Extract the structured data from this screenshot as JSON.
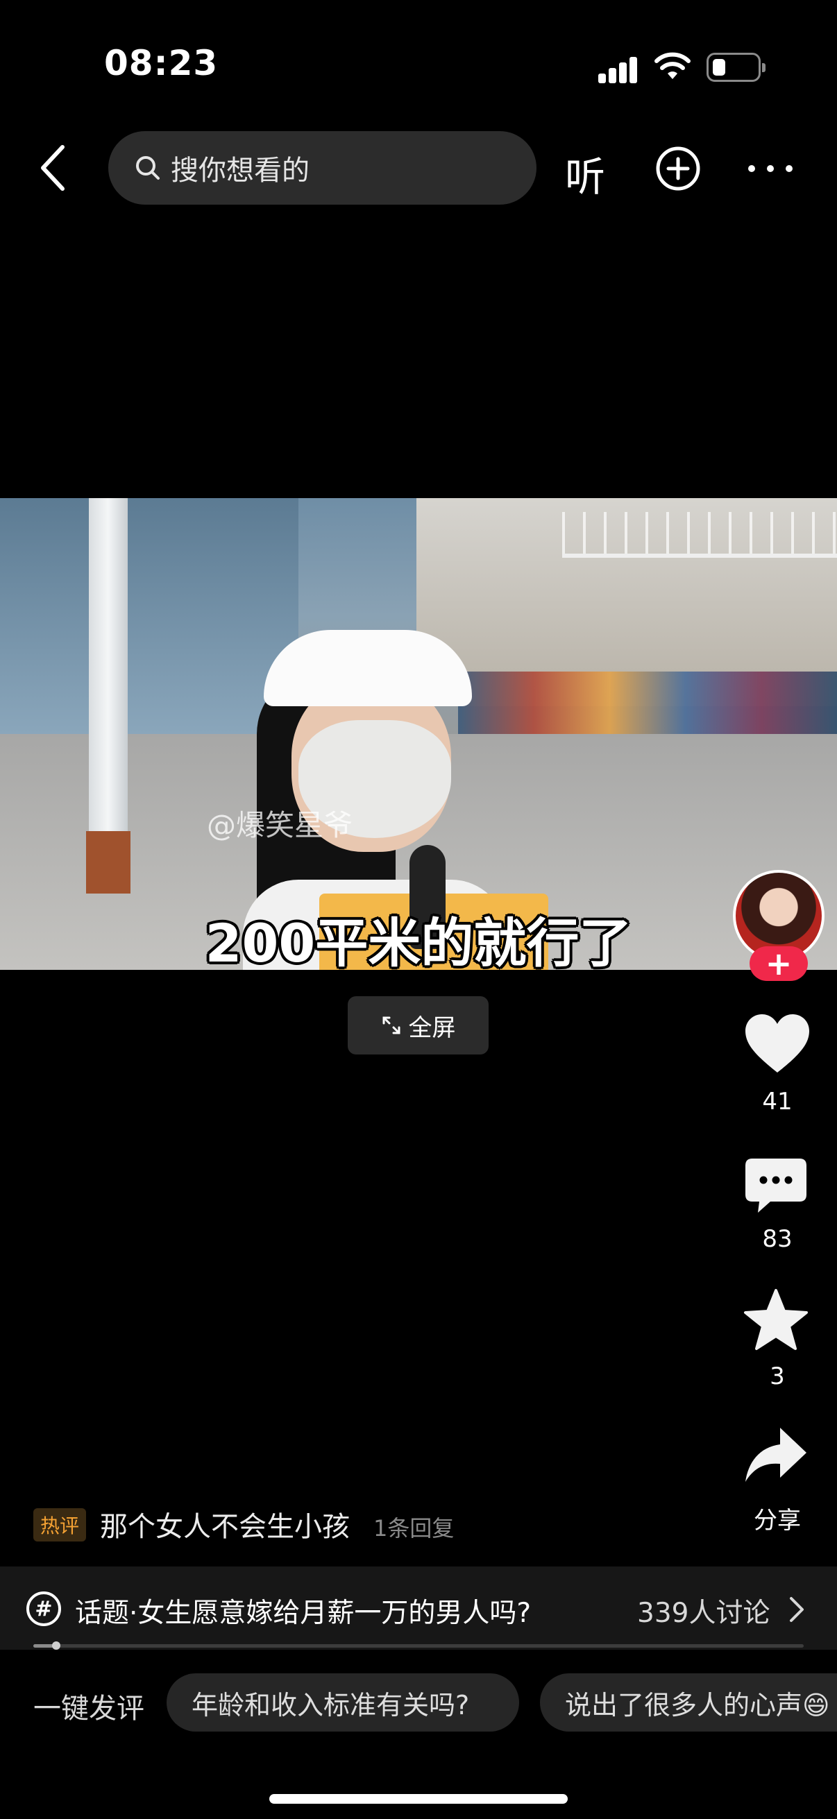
{
  "status_bar": {
    "time": "08:23",
    "battery_percent": 20
  },
  "top_nav": {
    "search_placeholder": "搜你想看的",
    "listen_label": "听",
    "icons": [
      "back-icon",
      "search-icon",
      "add-circle-icon",
      "more-icon"
    ]
  },
  "video": {
    "watermark": "@爆笑星爷",
    "subtitle": "200平米的就行了",
    "fullscreen_label": "全屏"
  },
  "actions": {
    "like_count": "41",
    "comment_count": "83",
    "favorite_count": "3",
    "share_label": "分享",
    "follow_plus": "+"
  },
  "hot_comment": {
    "tag": "热评",
    "text": "那个女人不会生小孩",
    "replies": "1条回复"
  },
  "topic": {
    "text": "话题·女生愿意嫁给月薪一万的男人吗?",
    "discussion_count": "339人讨论",
    "progress": 0.03
  },
  "quick_comment": {
    "label": "一键发评",
    "chips": [
      "年龄和收入标准有关吗?",
      "说出了很多人的心声😄"
    ]
  },
  "colors": {
    "accent_red": "#f0284a",
    "hot_tag": "#f4a133",
    "background": "#000000"
  }
}
